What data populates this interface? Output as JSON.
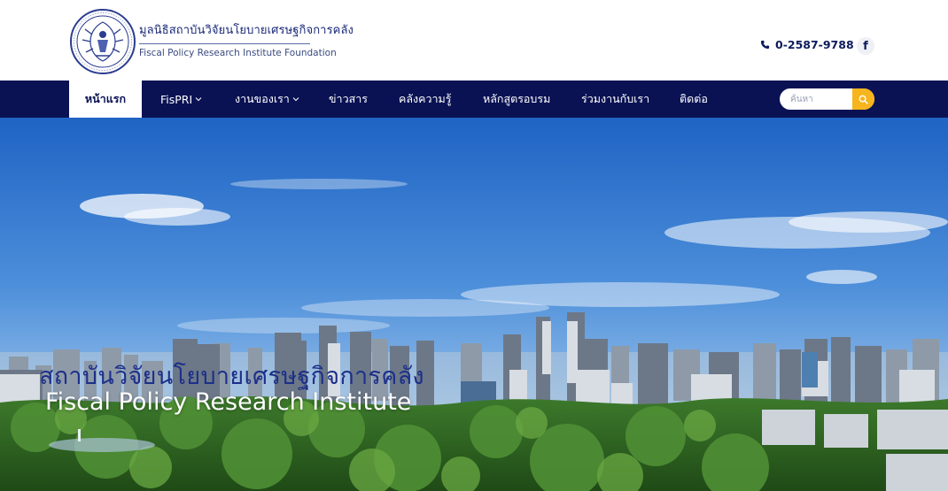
{
  "header": {
    "org_name_th": "มูลนิธิสถาบันวิจัยนโยบายเศรษฐกิจการคลัง",
    "org_name_en": "Fiscal Policy Research Institute Foundation",
    "phone": "0-2587-9788",
    "facebook_glyph": "f"
  },
  "nav": {
    "items": [
      {
        "label": "หน้าแรก",
        "active": true
      },
      {
        "label": "FisPRI",
        "has_dropdown": true
      },
      {
        "label": "งานของเรา",
        "has_dropdown": true
      },
      {
        "label": "ข่าวสาร"
      },
      {
        "label": "คลังความรู้"
      },
      {
        "label": "หลักสูตรอบรม"
      },
      {
        "label": "ร่วมงานกับเรา"
      },
      {
        "label": "ติดต่อ"
      }
    ],
    "search_placeholder": "ค้นหา"
  },
  "hero": {
    "title_th": "สถาบันวิจัยนโยบายเศรษฐกิจการคลัง",
    "title_en": "Fiscal Policy Research Institute"
  },
  "colors": {
    "navy": "#0a1254",
    "accent_yellow": "#f6b51e",
    "hero_title_th": "#1c2f8a"
  },
  "icons": [
    "fpri-logo-icon",
    "phone-icon",
    "facebook-icon",
    "chevron-down-icon",
    "search-icon"
  ]
}
